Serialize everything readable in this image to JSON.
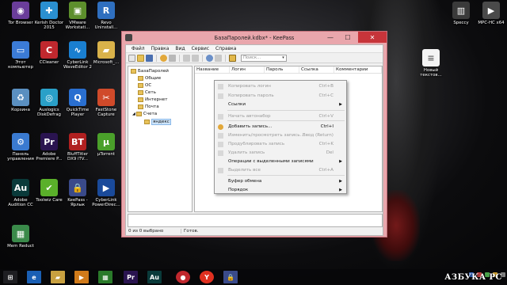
{
  "desktop": {
    "icons_left": [
      {
        "label": "Tor Browser",
        "icon": "tor-browser-icon",
        "color": "#6a3d9a",
        "glyph": "◉"
      },
      {
        "label": "Kerish Doctor\n2015",
        "icon": "kerish-doctor-icon",
        "color": "#2a8fd0",
        "glyph": "✚"
      },
      {
        "label": "VMware\nWorkstati...",
        "icon": "vmware-icon",
        "color": "#5d8f2c",
        "glyph": "▣"
      },
      {
        "label": "Revo\nUninstall...",
        "icon": "revo-uninstaller-icon",
        "color": "#2f6fbf",
        "glyph": "R"
      },
      {
        "label": "Этот\nкомпьютер",
        "icon": "this-computer-icon",
        "color": "#3b7bd6",
        "glyph": "▭"
      },
      {
        "label": "CCleaner",
        "icon": "ccleaner-icon",
        "color": "#c0282e",
        "glyph": "C"
      },
      {
        "label": "CyberLink\nWaveEditor 2",
        "icon": "cyberlink-waveeditor-icon",
        "color": "#1a7fd0",
        "glyph": "∿"
      },
      {
        "label": "Microsoft_...",
        "icon": "folder-icon",
        "color": "#d9b24a",
        "glyph": "▰"
      },
      {
        "label": "Корзина",
        "icon": "recycle-bin-icon",
        "color": "#5a8fc0",
        "glyph": "♻"
      },
      {
        "label": "Auslogics\nDiskDefrag",
        "icon": "auslogics-diskdefrag-icon",
        "color": "#2aa0c8",
        "glyph": "◎"
      },
      {
        "label": "QuickTime\nPlayer",
        "icon": "quicktime-icon",
        "color": "#2a6fd0",
        "glyph": "Q"
      },
      {
        "label": "FastStone\nCapture",
        "icon": "faststone-capture-icon",
        "color": "#d04a2a",
        "glyph": "✂"
      },
      {
        "label": "Панель\nуправления",
        "icon": "control-panel-icon",
        "color": "#3a7ad0",
        "glyph": "⚙"
      },
      {
        "label": "Adobe\nPremiere P...",
        "icon": "adobe-premiere-icon",
        "color": "#2a1450",
        "glyph": "Pr"
      },
      {
        "label": "BluffTitler\nDX9 iTV...",
        "icon": "blufftitler-icon",
        "color": "#b02020",
        "glyph": "BT"
      },
      {
        "label": "µTorrent",
        "icon": "utorrent-icon",
        "color": "#4aa02a",
        "glyph": "µ"
      },
      {
        "label": "Adobe\nAudition CC",
        "icon": "adobe-audition-icon",
        "color": "#0a3a3a",
        "glyph": "Au"
      },
      {
        "label": "Toolwiz Care",
        "icon": "toolwiz-care-icon",
        "color": "#5ab02a",
        "glyph": "✔"
      },
      {
        "label": "KeePass -\nЯрлык",
        "icon": "keepass-shortcut-icon",
        "color": "#3a4a8a",
        "glyph": "🔒"
      },
      {
        "label": "CyberLink\nPowerDirec...",
        "icon": "cyberlink-powerdirector-icon",
        "color": "#1a4a9a",
        "glyph": "▶"
      },
      {
        "label": "Mem Reduct",
        "icon": "mem-reduct-icon",
        "color": "#3a8a4a",
        "glyph": "▦"
      }
    ],
    "icons_right": [
      {
        "label": "Speccy",
        "icon": "speccy-icon",
        "color": "#3a3a3a",
        "glyph": "▥"
      },
      {
        "label": "MPC-HC x64",
        "icon": "mpc-hc-icon",
        "color": "#4a4a4a",
        "glyph": "▶"
      },
      {
        "label": "Новый\nтекстов...",
        "icon": "text-document-icon",
        "color": "#f4f4f4",
        "glyph": "≡"
      }
    ]
  },
  "window": {
    "title": "БазаПаролей.kdbx* - KeePass",
    "minimize": "—",
    "maximize": "☐",
    "close": "✕",
    "menu": [
      "Файл",
      "Правка",
      "Вид",
      "Сервис",
      "Справка"
    ],
    "search_placeholder": "Поиск...",
    "tree": [
      {
        "label": "БазаПаролей",
        "level": 0
      },
      {
        "label": "Общие",
        "level": 1
      },
      {
        "label": "ОС",
        "level": 1
      },
      {
        "label": "Сеть",
        "level": 1
      },
      {
        "label": "Интернет",
        "level": 1
      },
      {
        "label": "Почта",
        "level": 1
      },
      {
        "label": "Счета",
        "level": 1
      },
      {
        "label": "яндекс",
        "level": 2,
        "selected": true
      }
    ],
    "columns": [
      "Название",
      "Логин",
      "Пароль",
      "Ссылка",
      "Комментарии"
    ],
    "status_left": "0 из 0 выбрано",
    "status_right": "Готов."
  },
  "context_menu": {
    "items": [
      {
        "label": "Копировать логин",
        "shortcut": "Ctrl+B",
        "enabled": false,
        "submenu": false
      },
      {
        "label": "Копировать пароль",
        "shortcut": "Ctrl+C",
        "enabled": false,
        "submenu": false
      },
      {
        "label": "Ссылки",
        "shortcut": "",
        "enabled": true,
        "submenu": true
      },
      {
        "label": "Начать автонабор",
        "shortcut": "Ctrl+V",
        "enabled": false,
        "submenu": false
      },
      {
        "label": "Добавить запись...",
        "shortcut": "Ctrl+I",
        "enabled": true,
        "submenu": false
      },
      {
        "label": "Изменить/просмотреть запись...",
        "shortcut": "Ввод (Return)",
        "enabled": false,
        "submenu": false
      },
      {
        "label": "Продублировать запись",
        "shortcut": "Ctrl+K",
        "enabled": false,
        "submenu": false
      },
      {
        "label": "Удалить запись",
        "shortcut": "Del",
        "enabled": false,
        "submenu": false
      },
      {
        "label": "Операции с выделенными записями",
        "shortcut": "",
        "enabled": true,
        "submenu": true
      },
      {
        "label": "Выделить все",
        "shortcut": "Ctrl+A",
        "enabled": false,
        "submenu": false
      },
      {
        "label": "Буфер обмена",
        "shortcut": "",
        "enabled": true,
        "submenu": true
      },
      {
        "label": "Порядок",
        "shortcut": "",
        "enabled": true,
        "submenu": true
      }
    ]
  },
  "taskbar": {
    "items": [
      {
        "icon": "windows-start-icon",
        "color": "#1e1e22",
        "glyph": "⊞"
      },
      {
        "icon": "ie-icon",
        "color": "#1a5fb4",
        "glyph": "e"
      },
      {
        "icon": "file-explorer-icon",
        "color": "#c8a040",
        "glyph": "▰"
      },
      {
        "icon": "media-player-icon",
        "color": "#d07a1a",
        "glyph": "▶"
      },
      {
        "icon": "windows-store-icon",
        "color": "#2a7a2a",
        "glyph": "▦"
      },
      {
        "icon": "premiere-taskbar-icon",
        "color": "#2a1450",
        "glyph": "Pr"
      },
      {
        "icon": "audition-taskbar-icon",
        "color": "#0a3a3a",
        "glyph": "Au"
      },
      {
        "icon": "record-icon",
        "color": "#c0282e",
        "glyph": "●"
      },
      {
        "icon": "yandex-browser-icon",
        "color": "#e03020",
        "glyph": "Y"
      },
      {
        "icon": "keepass-taskbar-icon",
        "color": "#3a4a8a",
        "glyph": "🔒"
      }
    ],
    "watermark": "АЗБУКА PC"
  }
}
